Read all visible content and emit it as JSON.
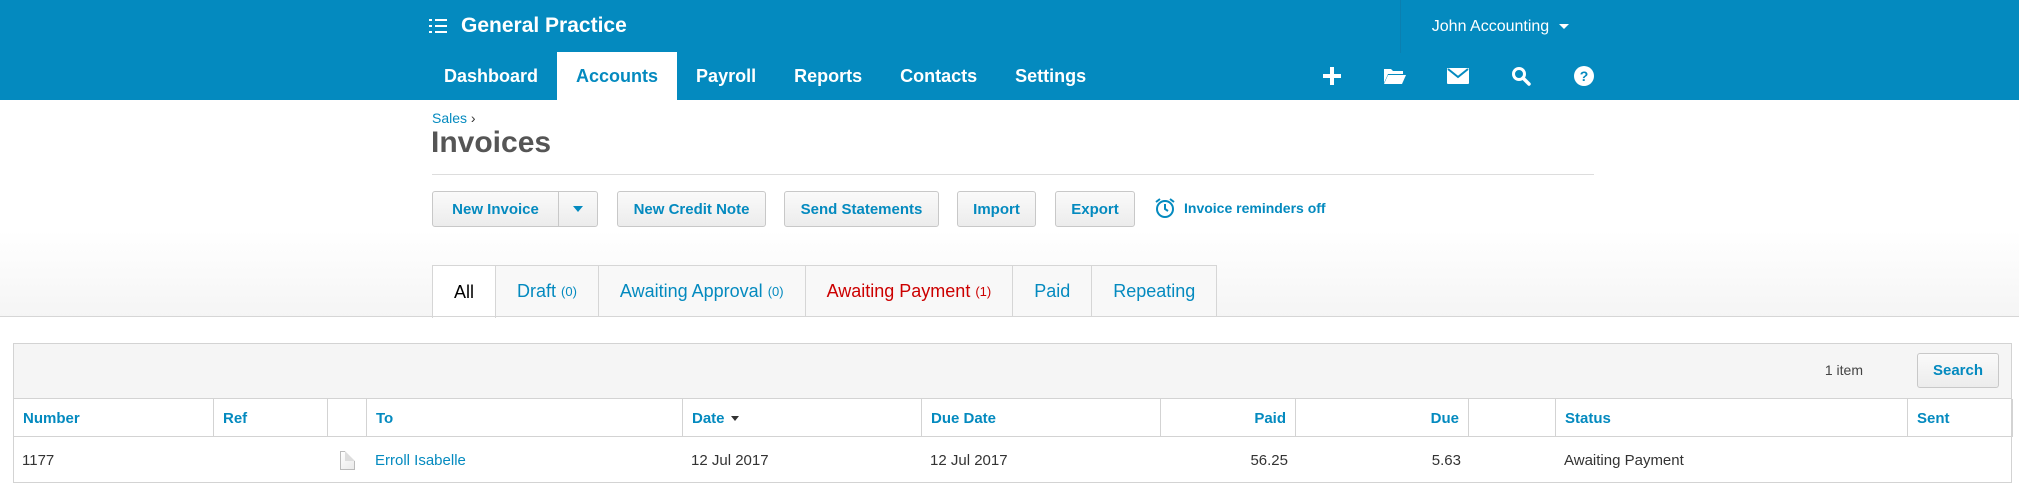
{
  "header": {
    "org_name": "General Practice",
    "user_name": "John Accounting",
    "nav": [
      {
        "label": "Dashboard"
      },
      {
        "label": "Accounts"
      },
      {
        "label": "Payroll"
      },
      {
        "label": "Reports"
      },
      {
        "label": "Contacts"
      },
      {
        "label": "Settings"
      }
    ],
    "active_tab": "Accounts",
    "icons": [
      "plus-icon",
      "folder-icon",
      "mail-icon",
      "search-icon",
      "help-icon"
    ],
    "brand_color": "#048abf"
  },
  "page": {
    "breadcrumb": "Sales",
    "breadcrumb_sep": "›",
    "title": "Invoices"
  },
  "actions": {
    "new_invoice": "New Invoice",
    "new_credit_note": "New Credit Note",
    "send_statements": "Send Statements",
    "import": "Import",
    "export": "Export",
    "reminders": "Invoice reminders off"
  },
  "status_tabs": [
    {
      "label": "All",
      "count": ""
    },
    {
      "label": "Draft",
      "count": "(0)"
    },
    {
      "label": "Awaiting Approval",
      "count": "(0)"
    },
    {
      "label": "Awaiting Payment",
      "count": "(1)"
    },
    {
      "label": "Paid",
      "count": ""
    },
    {
      "label": "Repeating",
      "count": ""
    }
  ],
  "table": {
    "item_count": "1 item",
    "search_label": "Search",
    "columns": {
      "number": "Number",
      "ref": "Ref",
      "to": "To",
      "date": "Date",
      "due_date": "Due Date",
      "paid": "Paid",
      "due": "Due",
      "status": "Status",
      "sent": "Sent"
    },
    "rows": [
      {
        "number": "1177",
        "ref": "",
        "to": "Erroll Isabelle",
        "date": "12 Jul 2017",
        "due_date": "12 Jul 2017",
        "paid": "56.25",
        "due": "5.63",
        "status": "Awaiting Payment",
        "sent": ""
      }
    ]
  }
}
